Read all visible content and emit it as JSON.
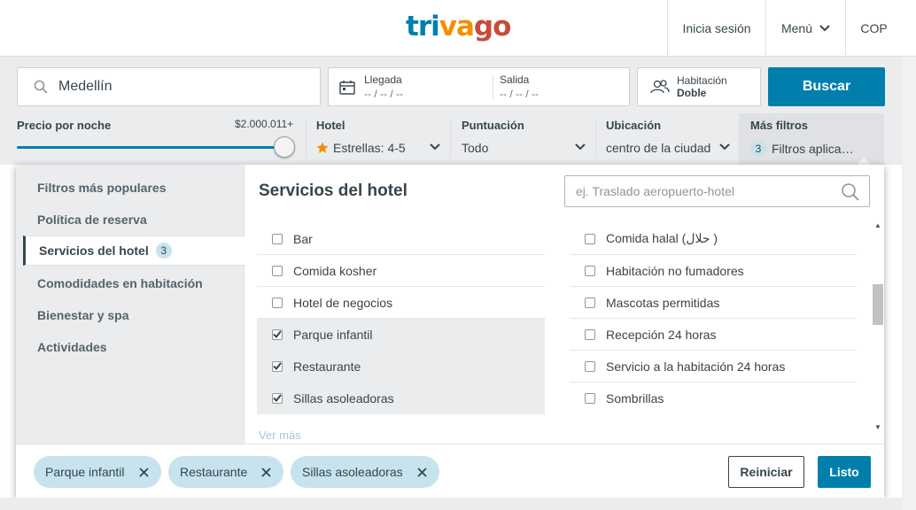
{
  "header": {
    "logo": {
      "part1": "tri",
      "part2": "va",
      "part3": "go"
    },
    "login": "Inicia sesión",
    "menu": "Menú",
    "currency": "COP"
  },
  "search": {
    "destination": "Medellín",
    "checkin_label": "Llegada",
    "checkin_value": "-- / -- / --",
    "checkout_label": "Salida",
    "checkout_value": "-- / -- / --",
    "room_label": "Habitación",
    "room_value": "Doble",
    "search_button": "Buscar"
  },
  "filters": {
    "price_label": "Precio por noche",
    "price_max": "$2.000.011+",
    "price_level_fraction": 1.0,
    "hotel_label": "Hotel",
    "hotel_value": "Estrellas: 4-5",
    "rating_label": "Puntuación",
    "rating_value": "Todo",
    "location_label": "Ubicación",
    "location_value": "centro de la ciudad",
    "more_label": "Más filtros",
    "more_count": "3",
    "more_value": "Filtros aplica…"
  },
  "panel": {
    "nav": [
      {
        "label": "Filtros más populares"
      },
      {
        "label": "Política de reserva"
      },
      {
        "label": "Servicios del hotel",
        "badge": "3",
        "active": true
      },
      {
        "label": "Comodidades en habitación"
      },
      {
        "label": "Bienestar y spa"
      },
      {
        "label": "Actividades"
      }
    ],
    "title": "Servicios del hotel",
    "search_placeholder": "ej. Traslado aeropuerto-hotel",
    "left_options": [
      {
        "label": "Bar",
        "checked": false
      },
      {
        "label": "Comida kosher",
        "checked": false
      },
      {
        "label": "Hotel de negocios",
        "checked": false
      },
      {
        "label": "Parque infantil",
        "checked": true
      },
      {
        "label": "Restaurante",
        "checked": true
      },
      {
        "label": "Sillas asoleadoras",
        "checked": true
      }
    ],
    "right_options": [
      {
        "label": "Comida halal (حلال )",
        "checked": false
      },
      {
        "label": "Habitación no fumadores",
        "checked": false
      },
      {
        "label": "Mascotas permitidas",
        "checked": false
      },
      {
        "label": "Recepción 24 horas",
        "checked": false
      },
      {
        "label": "Servicio a la habitación 24 horas",
        "checked": false
      },
      {
        "label": "Sombrillas",
        "checked": false
      }
    ],
    "more_link": "Ver más",
    "chips": [
      "Parque infantil",
      "Restaurante",
      "Sillas asoleadoras"
    ],
    "reset_button": "Reiniciar",
    "done_button": "Listo"
  }
}
